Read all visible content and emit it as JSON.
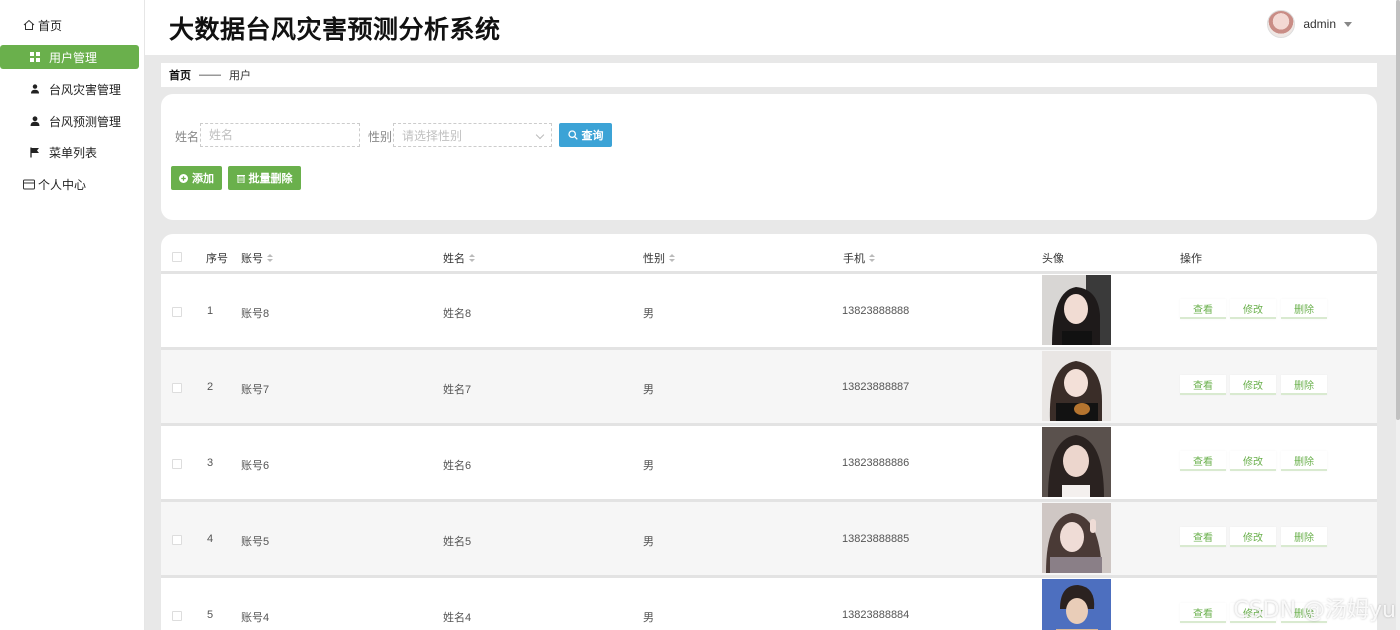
{
  "app_title": "大数据台风灾害预测分析系统",
  "user": {
    "name": "admin"
  },
  "sidebar": {
    "items": [
      {
        "label": "首页",
        "icon": "home-icon"
      },
      {
        "label": "用户管理",
        "icon": "grid-icon",
        "active": true
      },
      {
        "label": "台风灾害管理",
        "icon": "user-tie-icon"
      },
      {
        "label": "台风预测管理",
        "icon": "user-icon"
      },
      {
        "label": "菜单列表",
        "icon": "flag-icon"
      },
      {
        "label": "个人中心",
        "icon": "id-card-icon"
      }
    ]
  },
  "breadcrumb": {
    "home": "首页",
    "separator": "——",
    "current": "用户"
  },
  "search": {
    "name_label": "姓名",
    "name_placeholder": "姓名",
    "gender_label": "性别",
    "gender_placeholder": "请选择性别",
    "query_label": "查询",
    "add_label": "添加",
    "batch_delete_label": "批量删除"
  },
  "table": {
    "columns": {
      "index": "序号",
      "account": "账号",
      "name": "姓名",
      "gender": "性别",
      "phone": "手机",
      "avatar": "头像",
      "actions": "操作"
    },
    "action_labels": {
      "view": "查看",
      "edit": "修改",
      "delete": "删除"
    },
    "rows": [
      {
        "index": "1",
        "account": "账号8",
        "name": "姓名8",
        "gender": "男",
        "phone": "13823888888"
      },
      {
        "index": "2",
        "account": "账号7",
        "name": "姓名7",
        "gender": "男",
        "phone": "13823888887"
      },
      {
        "index": "3",
        "account": "账号6",
        "name": "姓名6",
        "gender": "男",
        "phone": "13823888886"
      },
      {
        "index": "4",
        "account": "账号5",
        "name": "姓名5",
        "gender": "男",
        "phone": "13823888885"
      },
      {
        "index": "5",
        "account": "账号4",
        "name": "姓名4",
        "gender": "男",
        "phone": "13823888884"
      }
    ]
  },
  "watermark": "CSDN @汤姆yu",
  "colors": {
    "accent_green": "#6ab04c",
    "query_blue": "#3ca3d6"
  }
}
